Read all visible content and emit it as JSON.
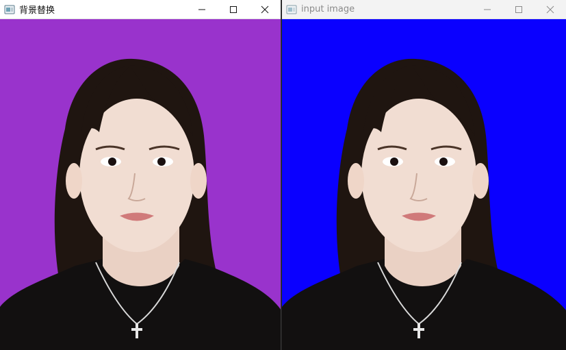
{
  "windows": [
    {
      "title": "背景替换",
      "background_color": "#9933cc",
      "state": "active"
    },
    {
      "title": "input image",
      "background_color": "#0a00ff",
      "state": "inactive"
    }
  ],
  "icons": {
    "app": "opencv-window-icon",
    "minimize": "minimize-icon",
    "maximize": "maximize-icon",
    "close": "close-icon"
  },
  "colors": {
    "hair": "#1f1510",
    "skin": "#f1ddd2",
    "shirt": "#121010",
    "lips": "#d07a7a"
  }
}
